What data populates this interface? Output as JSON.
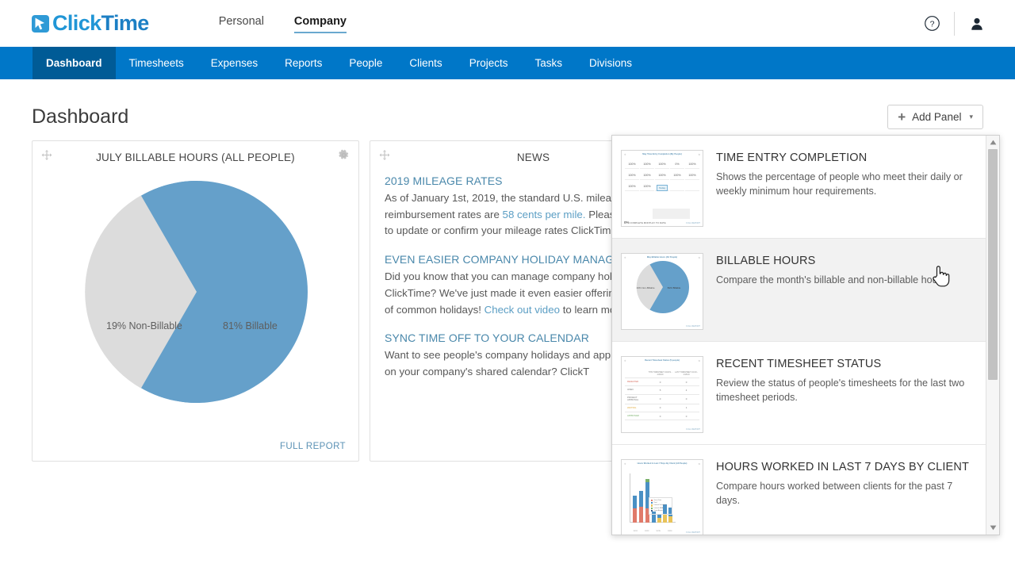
{
  "brand": {
    "name_click": "Click",
    "name_time": "Time",
    "logo_icon": "clicktime-logo-icon"
  },
  "header": {
    "tabs": [
      {
        "label": "Personal",
        "active": false
      },
      {
        "label": "Company",
        "active": true
      }
    ],
    "help_icon": "help-circle-icon",
    "account_icon": "user-account-icon"
  },
  "nav": {
    "items": [
      {
        "label": "Dashboard",
        "active": true
      },
      {
        "label": "Timesheets",
        "active": false
      },
      {
        "label": "Expenses",
        "active": false
      },
      {
        "label": "Reports",
        "active": false
      },
      {
        "label": "People",
        "active": false
      },
      {
        "label": "Clients",
        "active": false
      },
      {
        "label": "Projects",
        "active": false
      },
      {
        "label": "Tasks",
        "active": false
      },
      {
        "label": "Divisions",
        "active": false
      }
    ]
  },
  "page": {
    "title": "Dashboard",
    "add_panel_label": "Add Panel",
    "add_panel_icon": "plus-icon",
    "add_panel_caret": "▾"
  },
  "panels": {
    "pie": {
      "title": "JULY BILLABLE HOURS (ALL PEOPLE)",
      "drag_icon": "drag-move-icon",
      "gear_icon": "gear-icon",
      "full_report": "FULL REPORT",
      "label_nonbillable": "19% Non-Billable",
      "label_billable": "81% Billable"
    },
    "news": {
      "title": "NEWS",
      "drag_icon": "drag-move-icon",
      "items": [
        {
          "headline": "2019 MILEAGE RATES",
          "text_a": "As of January 1st, 2019, the standard U.S. mileage reimbursement rates are ",
          "link": "58 cents per mile.",
          "text_b": " Please a moment to update or confirm your mileage rates ClickTime."
        },
        {
          "headline": "EVEN EASIER COMPANY HOLIDAY MANAGEMENT",
          "text_a": "Did you know that you can manage company holiday hours in ClickTime? We've just made it even easier offering preset lists of common holidays! ",
          "link": "Check out video",
          "text_b": " to learn more."
        },
        {
          "headline": "SYNC TIME OFF TO YOUR CALENDAR",
          "text_a": "Want to see people's company holidays and approved time off on your company's shared calendar? ClickT",
          "link": "",
          "text_b": ""
        }
      ]
    }
  },
  "chart_data": {
    "type": "pie",
    "title": "JULY BILLABLE HOURS (ALL PEOPLE)",
    "categories": [
      "Billable",
      "Non-Billable"
    ],
    "values": [
      81,
      19
    ],
    "labels": [
      "81% Billable",
      "19% Non-Billable"
    ],
    "colors": [
      "#65a0ca",
      "#dcdcdc"
    ],
    "units": "percent",
    "legend": "inline-labels",
    "grid": false
  },
  "dropdown": {
    "scrollbar": {
      "up_icon": "scroll-up-arrow-icon",
      "down_icon": "scroll-down-arrow-icon"
    },
    "items": [
      {
        "title": "TIME ENTRY COMPLETION",
        "description": "Shows the percentage of people who meet their daily or weekly minimum hour requirements.",
        "thumbnail": "calendar-completion-thumbnail",
        "hovered": false,
        "thumb": {
          "title": "May Time Entry Completion (My People)",
          "full_report": "FULL REPORT",
          "cells": [
            "100%",
            "100%",
            "100%",
            "0%",
            "100%",
            "100%",
            "100%",
            "100%",
            "100%",
            "100%",
            "100%",
            "100%",
            "Today",
            "",
            ""
          ],
          "today_label": "Today",
          "footer_pct": "0%",
          "footer_text": "COMPLETE MONTHLY TO DATE"
        }
      },
      {
        "title": "BILLABLE HOURS",
        "description": "Compare the month's billable and non-billable hours.",
        "thumbnail": "pie-billable-thumbnail",
        "hovered": true,
        "thumb": {
          "title": "May Billable Hours (All People)",
          "full_report": "FULL REPORT",
          "label_a": "19% Non-Billable",
          "label_b": "81% Billable"
        }
      },
      {
        "title": "RECENT TIMESHEET STATUS",
        "description": "Review the status of people's timesheets for the last two timesheet periods.",
        "thumbnail": "timesheet-status-table-thumbnail",
        "hovered": false,
        "thumb": {
          "title": "Recent Timesheet Status (5 people)",
          "full_report": "FULL REPORT",
          "col1": "THIS TIMESHEET 4/16/19 - 4/30/19",
          "col2": "LAST TIMESHEET 4/1/19 - 4/15/19",
          "rows": [
            {
              "label": "REJECTED",
              "a": "0",
              "b": "0",
              "color": "#d86a5c"
            },
            {
              "label": "OPEN",
              "a": "5",
              "b": "4",
              "color": "#7a7a7a"
            },
            {
              "label": "PROJECT APPROVAL",
              "a": "0",
              "b": "0",
              "color": "#7a7a7a"
            },
            {
              "label": "WAITING",
              "a": "0",
              "b": "1",
              "color": "#e0a93b"
            },
            {
              "label": "APPROVED",
              "a": "0",
              "b": "0",
              "color": "#77b06a"
            }
          ]
        }
      },
      {
        "title": "HOURS WORKED IN LAST 7 DAYS BY CLIENT",
        "description": "Compare hours worked between clients for the past 7 days.",
        "thumbnail": "stacked-bar-hours-thumbnail",
        "hovered": false,
        "thumb": {
          "title": "Hours Worked in Last 7 Days By Client (All People)",
          "full_report": "FULL REPORT",
          "ylabel": "Hours",
          "yticks": [
            "30",
            "25",
            "20",
            "15",
            "10",
            "5",
            "0"
          ],
          "xticks": [
            "10/11",
            "10/13",
            "10/15",
            "10/16"
          ],
          "legend": [
            "Great Data",
            "Pixel",
            "Limited Technical",
            "Limited JAVA",
            "Virgin Airport"
          ]
        }
      }
    ]
  },
  "cursor": {
    "icon": "pointing-hand-cursor"
  },
  "colors": {
    "nav_blue": "#0077c8",
    "nav_active_blue": "#005b96",
    "brand_blue": "#2196d6",
    "pie_blue": "#65a0ca",
    "pie_gray": "#dcdcdc",
    "link_blue": "#4a88ab"
  }
}
